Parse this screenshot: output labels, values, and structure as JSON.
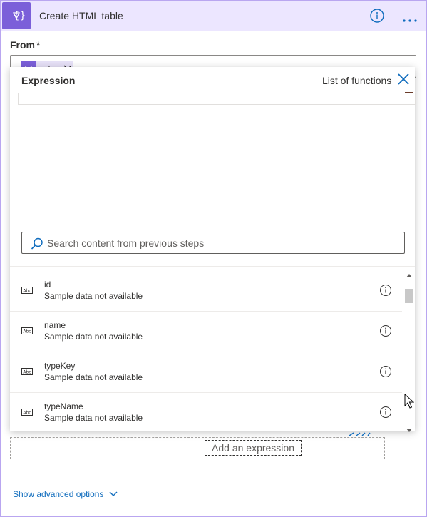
{
  "card": {
    "title": "Create HTML table",
    "accent_color": "#7b5fd9",
    "header_bg": "#ece6ff",
    "icons": {
      "action": "variable-braces-icon",
      "info": "info-icon",
      "more": "more-icon"
    }
  },
  "from": {
    "label": "From",
    "required_mark": "*",
    "token": {
      "label": "value",
      "icon": "expression-icon",
      "icon_text": "{x}"
    }
  },
  "expression_panel": {
    "tab_label": "Expression",
    "functions_link": "List of functions",
    "search_placeholder": "Search content from previous steps",
    "items": [
      {
        "name": "id",
        "subtitle": "Sample data not available",
        "icon": "string-type-icon"
      },
      {
        "name": "name",
        "subtitle": "Sample data not available",
        "icon": "string-type-icon"
      },
      {
        "name": "typeKey",
        "subtitle": "Sample data not available",
        "icon": "string-type-icon"
      },
      {
        "name": "typeName",
        "subtitle": "Sample data not available",
        "icon": "string-type-icon"
      }
    ]
  },
  "table": {
    "add_expression_label": "Add an expression"
  },
  "footer": {
    "advanced_label": "Show advanced options"
  },
  "colors": {
    "link": "#0f6cbd",
    "border": "#8a8886"
  }
}
